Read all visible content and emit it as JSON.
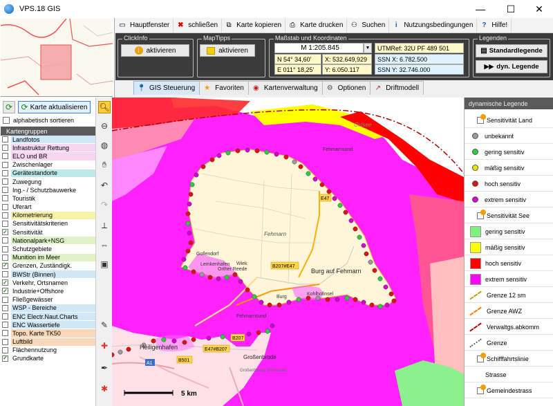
{
  "window": {
    "title": "VPS.18  GIS",
    "minimize": "—",
    "maximize": "☐",
    "close": "✕"
  },
  "toolbar": {
    "items": [
      {
        "label": "Hauptfenster",
        "icon": "window-icon"
      },
      {
        "label": "schließen",
        "icon": "close-circle-icon"
      },
      {
        "label": "Karte kopieren",
        "icon": "copy-icon"
      },
      {
        "label": "Karte drucken",
        "icon": "printer-icon"
      },
      {
        "label": "Suchen",
        "icon": "binoculars-icon"
      },
      {
        "label": "Nutzungsbedingungen",
        "icon": "info-icon"
      },
      {
        "label": "Hilfe!",
        "icon": "help-icon"
      }
    ]
  },
  "clickinfo": {
    "title": "ClickInfo",
    "button": "aktivieren"
  },
  "maptipps": {
    "title": "MapTipps",
    "button": "aktivieren"
  },
  "coords": {
    "title": "Maßstab und Koordinaten",
    "scale": "M 1:205.845",
    "lat": "N 54° 34,60'",
    "lon": "E 011° 18,25'",
    "x": "X: 532.649,929",
    "y": "Y: 6.050.117",
    "utm": "UTMRef: 32U PF 489 501",
    "ssn_x": "SSN X: 6.782.500",
    "ssn_y": "SSN Y: 32.746.000"
  },
  "legenden": {
    "title": "Legenden",
    "standard": "Standardlegende",
    "dyn": "dyn. Legende"
  },
  "tabs": [
    {
      "label": "GIS Steuerung",
      "icon": "pin-icon",
      "active": true
    },
    {
      "label": "Favoriten",
      "icon": "star-icon",
      "active": false
    },
    {
      "label": "Kartenverwaltung",
      "icon": "map-manage-icon",
      "active": false
    },
    {
      "label": "Optionen",
      "icon": "gear-icon",
      "active": false
    },
    {
      "label": "Driftmodell",
      "icon": "drift-icon",
      "active": false
    }
  ],
  "left": {
    "refresh_label": "Karte aktualisieren",
    "sort_label": "alphabetisch sortieren",
    "groups_header": "Kartengruppen"
  },
  "layers": [
    {
      "label": "Landfotos",
      "checked": false,
      "color": "#cfe7f7"
    },
    {
      "label": "Infrastruktur Rettung",
      "checked": false,
      "color": "#f7d6f2"
    },
    {
      "label": "ELO und BR",
      "checked": false,
      "color": "#f7d6f2"
    },
    {
      "label": "Zwischenlager",
      "checked": false,
      "color": "#ffffff"
    },
    {
      "label": "Gerätestandorte",
      "checked": false,
      "color": "#bfe8e8"
    },
    {
      "label": "Zuwegung",
      "checked": false,
      "color": "#ffffff"
    },
    {
      "label": "Ing.- / Schutzbauwerke",
      "checked": false,
      "color": "#ffffff"
    },
    {
      "label": "Touristik",
      "checked": false,
      "color": "#ffffff"
    },
    {
      "label": "Uferart",
      "checked": false,
      "color": "#ffffff"
    },
    {
      "label": "Kilometrierung",
      "checked": false,
      "color": "#f7f2a8"
    },
    {
      "label": "Sensitivitätskriterien",
      "checked": false,
      "color": "#ffffff"
    },
    {
      "label": "Sensitivität",
      "checked": true,
      "color": "#ffffff"
    },
    {
      "label": "Nationalpark+NSG",
      "checked": false,
      "color": "#dff2c8"
    },
    {
      "label": "Schutzgebiete",
      "checked": false,
      "color": "#ffffff"
    },
    {
      "label": "Munition im Meer",
      "checked": false,
      "color": "#dff2c8"
    },
    {
      "label": "Grenzen, Zuständigk.",
      "checked": true,
      "color": "#ffffff"
    },
    {
      "label": "BWStr (Binnen)",
      "checked": false,
      "color": "#cfe7f7"
    },
    {
      "label": "Verkehr, Ortsnamen",
      "checked": true,
      "color": "#ffffff"
    },
    {
      "label": "Industrie+Offshore",
      "checked": true,
      "color": "#ffffff"
    },
    {
      "label": "Fließgewässer",
      "checked": false,
      "color": "#ffffff"
    },
    {
      "label": "WSP - Bereiche",
      "checked": false,
      "color": "#cfe7f7"
    },
    {
      "label": "ENC Electr.Naut.Charts",
      "checked": false,
      "color": "#cfe7f7"
    },
    {
      "label": "ENC Wassertiefe",
      "checked": false,
      "color": "#cfe7f7"
    },
    {
      "label": "Topo. Karte TK50",
      "checked": false,
      "color": "#f8d8b8"
    },
    {
      "label": "Luftbild",
      "checked": false,
      "color": "#f8d8b8"
    },
    {
      "label": "Flächennutzung",
      "checked": false,
      "color": "#ffffff"
    },
    {
      "label": "Grundkarte",
      "checked": true,
      "color": "#ffffff"
    }
  ],
  "map": {
    "labels": {
      "ostsee": "Ostsee",
      "fehmarnsund": "Fehmarnsund",
      "fehmarn": "Fehmarn",
      "burg": "Burg auf Fehmarn",
      "lemkenhafen": "Lemkenhafen",
      "orther_reede": "Orther Reede",
      "wiek": "Wiek",
      "burg2": "Burg",
      "kohlhofinsel": "Kohlhofinsel",
      "heiligenhafen": "Heiligenhafen",
      "grossenbrode": "Großenbrode",
      "grossenbroder_binnensee": "Großenbroder Binnensee",
      "fehmarnsund2": "Fehmarnsund",
      "gollendorf": "Gollendorf"
    },
    "roads": {
      "e47": "E47",
      "b207e47": "B207#E47",
      "b207": "B207",
      "e47b207": "E47#B207",
      "a1": "A1",
      "b501": "B501"
    },
    "scalebar": "5 km"
  },
  "legend": {
    "header": "dynamische Legende",
    "items": [
      {
        "kind": "group",
        "label": "Sensitivität Land"
      },
      {
        "kind": "dot",
        "label": "unbekannt",
        "color": "#9a9a9a"
      },
      {
        "kind": "dot",
        "label": "gering sensitiv",
        "color": "#2ecc40"
      },
      {
        "kind": "dot",
        "label": "mäßig sensitiv",
        "color": "#f5e400"
      },
      {
        "kind": "dot",
        "label": "hoch sensitiv",
        "color": "#e01010"
      },
      {
        "kind": "dot",
        "label": "extrem sensitiv",
        "color": "#d600d6"
      },
      {
        "kind": "group",
        "label": "Sensitivität See"
      },
      {
        "kind": "sq",
        "label": "gering sensitiv",
        "color": "#7ff07f"
      },
      {
        "kind": "sq",
        "label": "mäßig sensitiv",
        "color": "#ffff00"
      },
      {
        "kind": "sq",
        "label": "hoch sensitiv",
        "color": "#ff0000"
      },
      {
        "kind": "sq",
        "label": "extrem sensitiv",
        "color": "#ff00ff"
      },
      {
        "kind": "line",
        "label": "Grenze 12 sm",
        "color": "#c0a000"
      },
      {
        "kind": "line",
        "label": "Grenze AWZ",
        "color": "#ff7a00"
      },
      {
        "kind": "line",
        "label": "Verwaltgs.abkomm",
        "color": "#b00000"
      },
      {
        "kind": "dashed",
        "label": "Grenze",
        "color": "#666666"
      },
      {
        "kind": "group",
        "label": "Schifffahrtslinie"
      },
      {
        "kind": "plain",
        "label": "Strasse"
      },
      {
        "kind": "group",
        "label": "Gemeindestrass"
      }
    ]
  }
}
